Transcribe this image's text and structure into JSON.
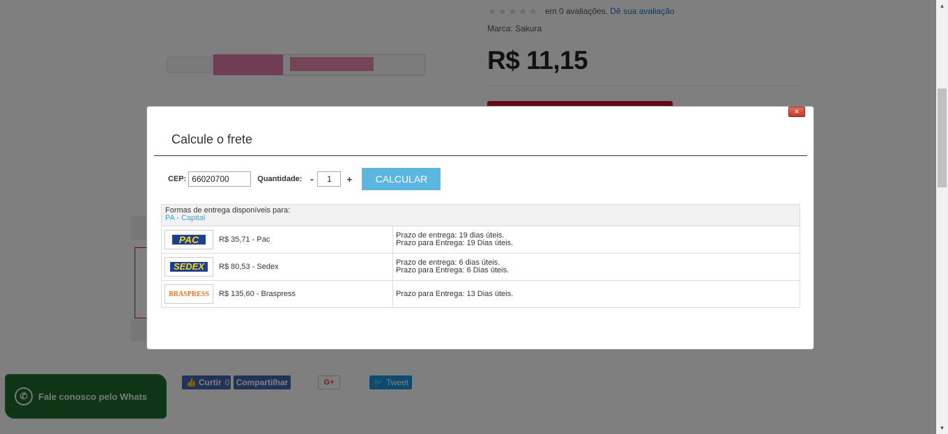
{
  "product": {
    "rating_text": "em 0 avaliações.",
    "rating_link": "Dê sua avaliação",
    "brand": "Marca: Sakura",
    "price": "R$ 11,15",
    "stars": 0
  },
  "social": {
    "like_label": "Curtir",
    "like_count": "0",
    "share_label": "Compartilhar",
    "gplus_label": "G+",
    "tweet_label": "Tweet"
  },
  "whats": {
    "label": "Fale conosco pelo Whats",
    "icon": "whatsapp-icon"
  },
  "modal": {
    "close_label": "×",
    "title": "Calcule o frete",
    "cep_label": "CEP:",
    "cep_value": "66020700",
    "qty_label": "Quantidade:",
    "qty_minus": "-",
    "qty_value": "1",
    "qty_plus": "+",
    "calc_label": "CALCULAR",
    "results_header": "Formas de entrega disponíveis para:",
    "results_location": "PA - Capital",
    "rows": [
      {
        "logo": "PAC",
        "price": "R$ 35,71 - Pac",
        "line1": "Prazo de entrega: 19 dias úteis.",
        "line2": "Prazo para Entrega: 19 Dias úteis."
      },
      {
        "logo": "SEDEX",
        "price": "R$ 80,53 - Sedex",
        "line1": "Prazo de entrega: 6 dias úteis.",
        "line2": "Prazo para Entrega: 6 Dias úteis."
      },
      {
        "logo": "BRASPRESS",
        "price": "R$ 135,60 - Braspress",
        "line1": "Prazo para Entrega: 13 Dias úteis.",
        "line2": ""
      }
    ]
  },
  "colors": {
    "accent": "#5bb7e0",
    "buy_button": "#c9102c",
    "link": "#1a6fc9"
  }
}
